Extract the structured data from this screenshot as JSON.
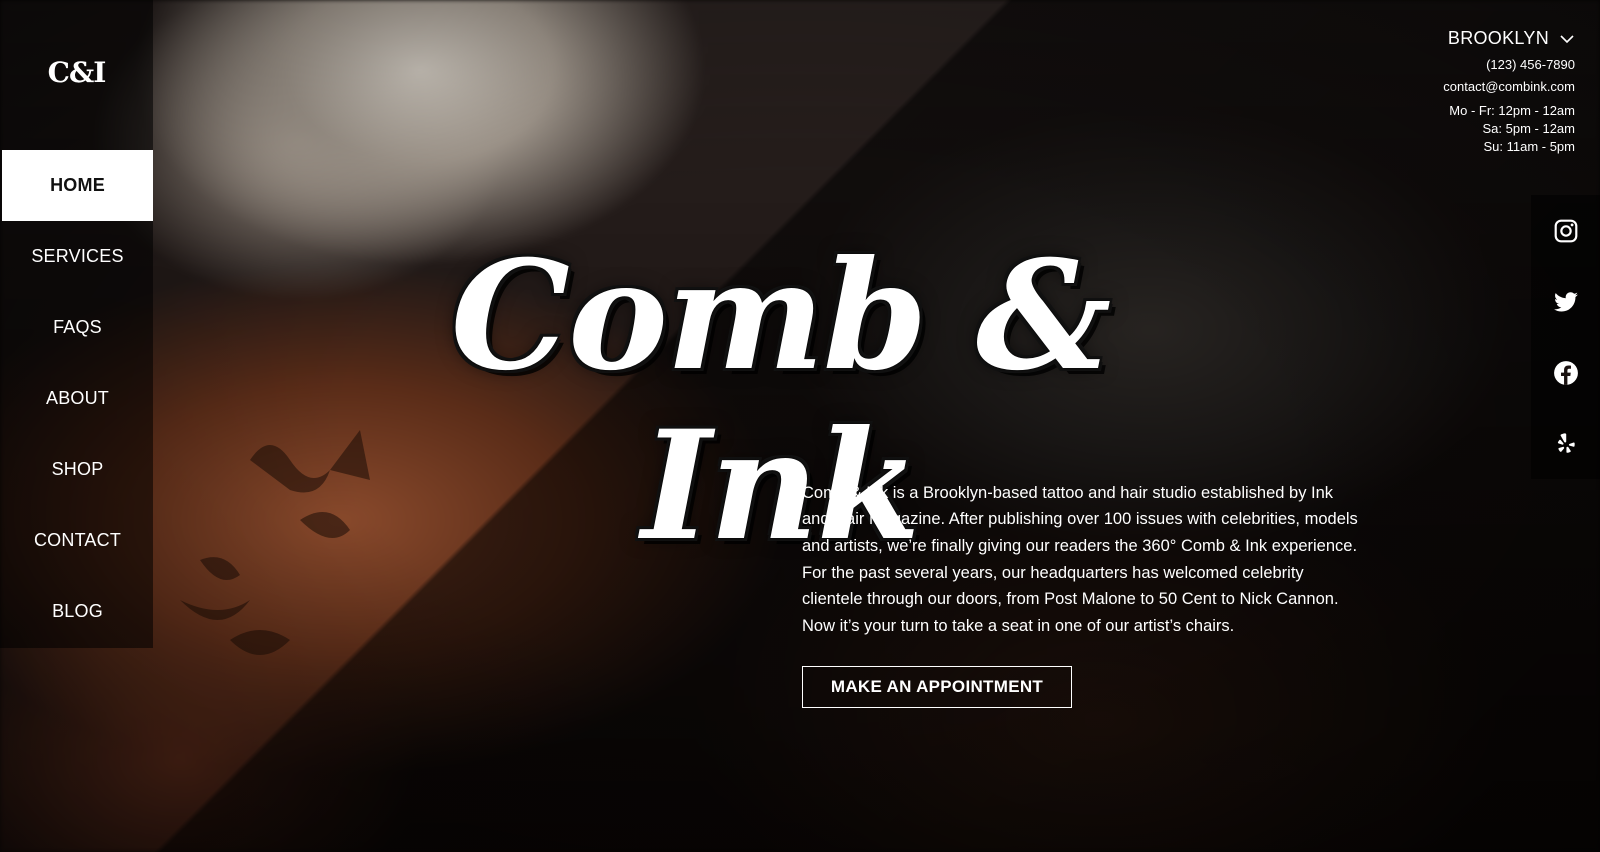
{
  "brand": {
    "logo_text": "C&I"
  },
  "nav": {
    "items": [
      {
        "label": "HOME",
        "active": true
      },
      {
        "label": "SERVICES",
        "active": false
      },
      {
        "label": "FAQS",
        "active": false
      },
      {
        "label": "ABOUT",
        "active": false
      },
      {
        "label": "SHOP",
        "active": false
      },
      {
        "label": "CONTACT",
        "active": false
      },
      {
        "label": "BLOG",
        "active": false
      }
    ]
  },
  "info": {
    "location": "BROOKLYN",
    "phone": "(123) 456-7890",
    "email": "contact@combink.com",
    "hours": [
      "Mo - Fr: 12pm - 12am",
      "Sa: 5pm - 12am",
      "Su: 11am - 5pm"
    ]
  },
  "social": {
    "icons": [
      "instagram-icon",
      "twitter-icon",
      "facebook-icon",
      "yelp-icon"
    ]
  },
  "hero": {
    "title": "Comb & Ink",
    "description": "Comb & Ink is a Brooklyn-based tattoo and hair studio established by Ink and Hair Magazine. After publishing over 100 issues with celebrities, models and artists, we’re finally giving our readers the 360° Comb & Ink experience. For the past several years, our headquarters has welcomed celebrity clientele through our doors, from Post Malone to 50 Cent to Nick Cannon. Now it’s your turn to take a seat in one of our artist’s chairs.",
    "cta_label": "MAKE AN APPOINTMENT"
  },
  "colors": {
    "accent": "#ffffff",
    "panel": "#000000"
  }
}
